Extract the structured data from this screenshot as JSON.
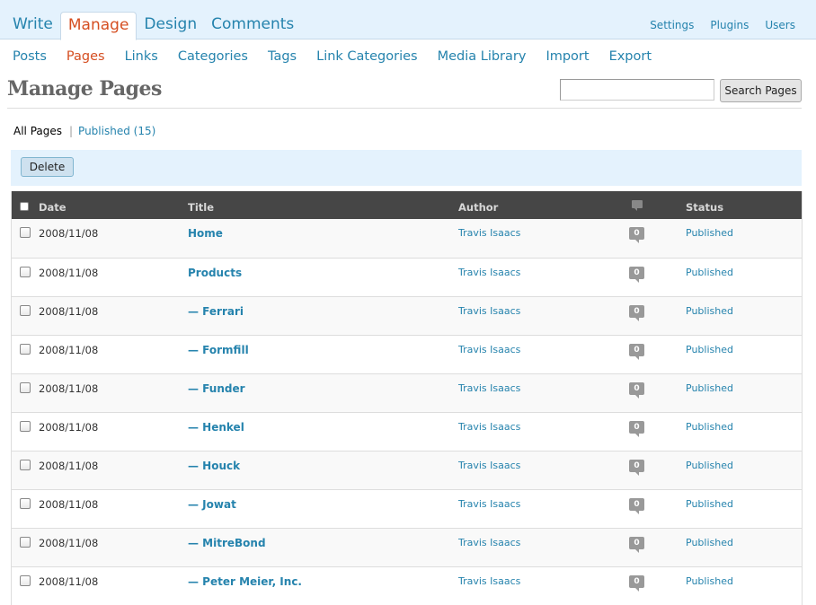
{
  "main_tabs": [
    "Write",
    "Manage",
    "Design",
    "Comments"
  ],
  "right_tabs": [
    "Settings",
    "Plugins",
    "Users"
  ],
  "sub_nav": [
    "Posts",
    "Pages",
    "Links",
    "Categories",
    "Tags",
    "Link Categories",
    "Media Library",
    "Import",
    "Export"
  ],
  "page_title": "Manage Pages",
  "search_button": "Search Pages",
  "search_value": "",
  "filters": {
    "all": "All Pages",
    "separator": "|",
    "published": "Published (15)"
  },
  "delete_button": "Delete",
  "columns": {
    "date": "Date",
    "title": "Title",
    "author": "Author",
    "status": "Status"
  },
  "rows": [
    {
      "date": "2008/11/08",
      "title": "Home",
      "author": "Travis Isaacs",
      "comments": "0",
      "status": "Published"
    },
    {
      "date": "2008/11/08",
      "title": "Products",
      "author": "Travis Isaacs",
      "comments": "0",
      "status": "Published"
    },
    {
      "date": "2008/11/08",
      "title": "— Ferrari",
      "author": "Travis Isaacs",
      "comments": "0",
      "status": "Published"
    },
    {
      "date": "2008/11/08",
      "title": "— Formfill",
      "author": "Travis Isaacs",
      "comments": "0",
      "status": "Published"
    },
    {
      "date": "2008/11/08",
      "title": "— Funder",
      "author": "Travis Isaacs",
      "comments": "0",
      "status": "Published"
    },
    {
      "date": "2008/11/08",
      "title": "— Henkel",
      "author": "Travis Isaacs",
      "comments": "0",
      "status": "Published"
    },
    {
      "date": "2008/11/08",
      "title": "— Houck",
      "author": "Travis Isaacs",
      "comments": "0",
      "status": "Published"
    },
    {
      "date": "2008/11/08",
      "title": "— Jowat",
      "author": "Travis Isaacs",
      "comments": "0",
      "status": "Published"
    },
    {
      "date": "2008/11/08",
      "title": "— MitreBond",
      "author": "Travis Isaacs",
      "comments": "0",
      "status": "Published"
    },
    {
      "date": "2008/11/08",
      "title": "— Peter Meier, Inc.",
      "author": "Travis Isaacs",
      "comments": "0",
      "status": "Published"
    }
  ]
}
